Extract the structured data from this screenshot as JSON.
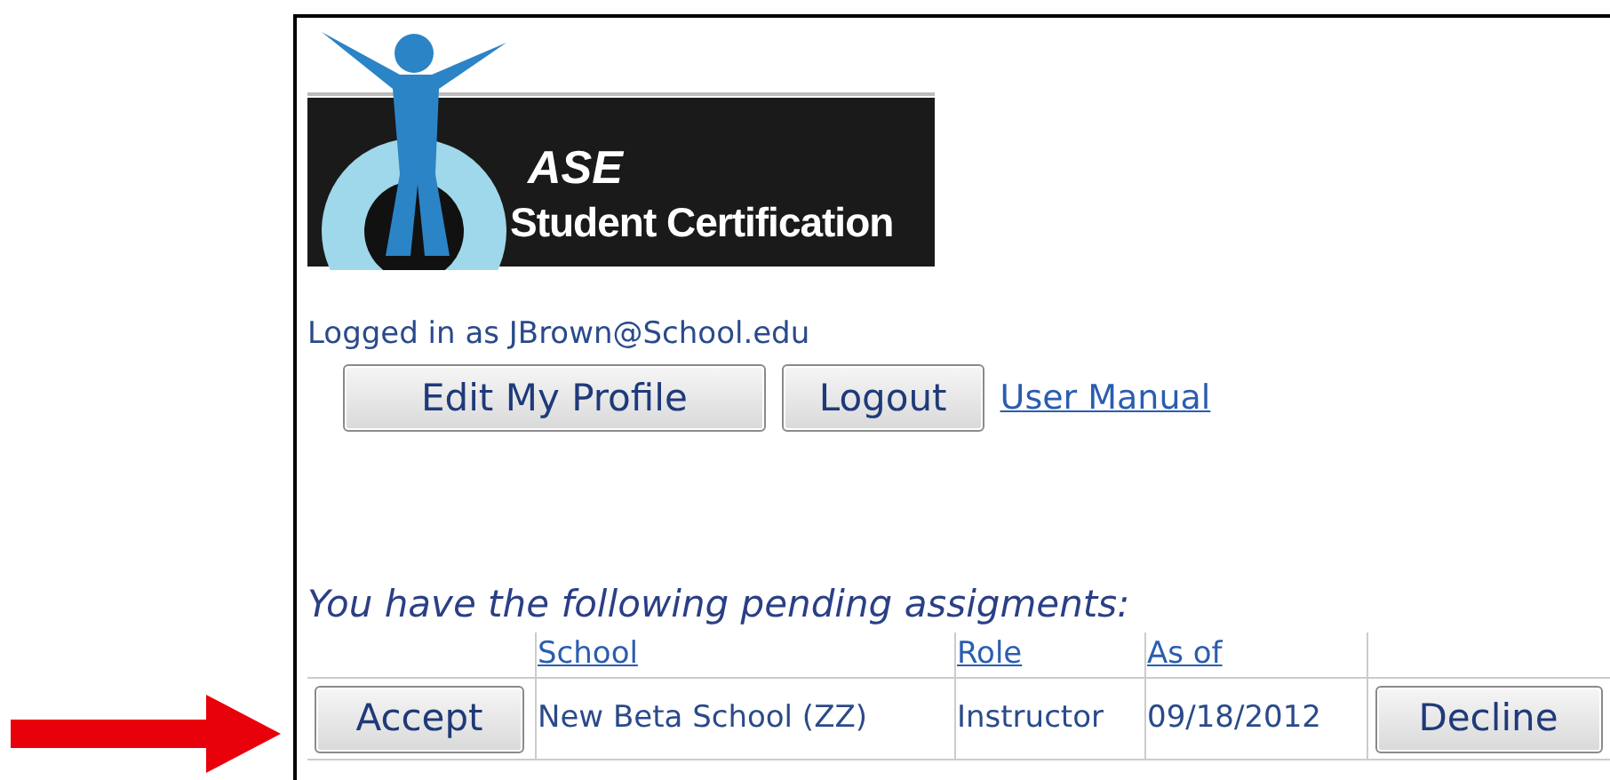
{
  "logo": {
    "brand": "ASE",
    "subtitle": "Student Certification"
  },
  "login_status": "Logged in as JBrown@School.edu",
  "buttons": [
    {
      "kind": "button",
      "label": "Edit My Profile"
    },
    {
      "kind": "button",
      "label": "Logout"
    },
    {
      "kind": "link",
      "label": "User Manual"
    }
  ],
  "heading": "You have the following pending assigments:",
  "table": {
    "columns": [
      "School",
      "Role",
      "As of"
    ],
    "rows": [
      {
        "accept": "Accept",
        "school": "New Beta School (ZZ)",
        "role": "Instructor",
        "as_of": "09/18/2012",
        "decline": "Decline"
      }
    ]
  }
}
